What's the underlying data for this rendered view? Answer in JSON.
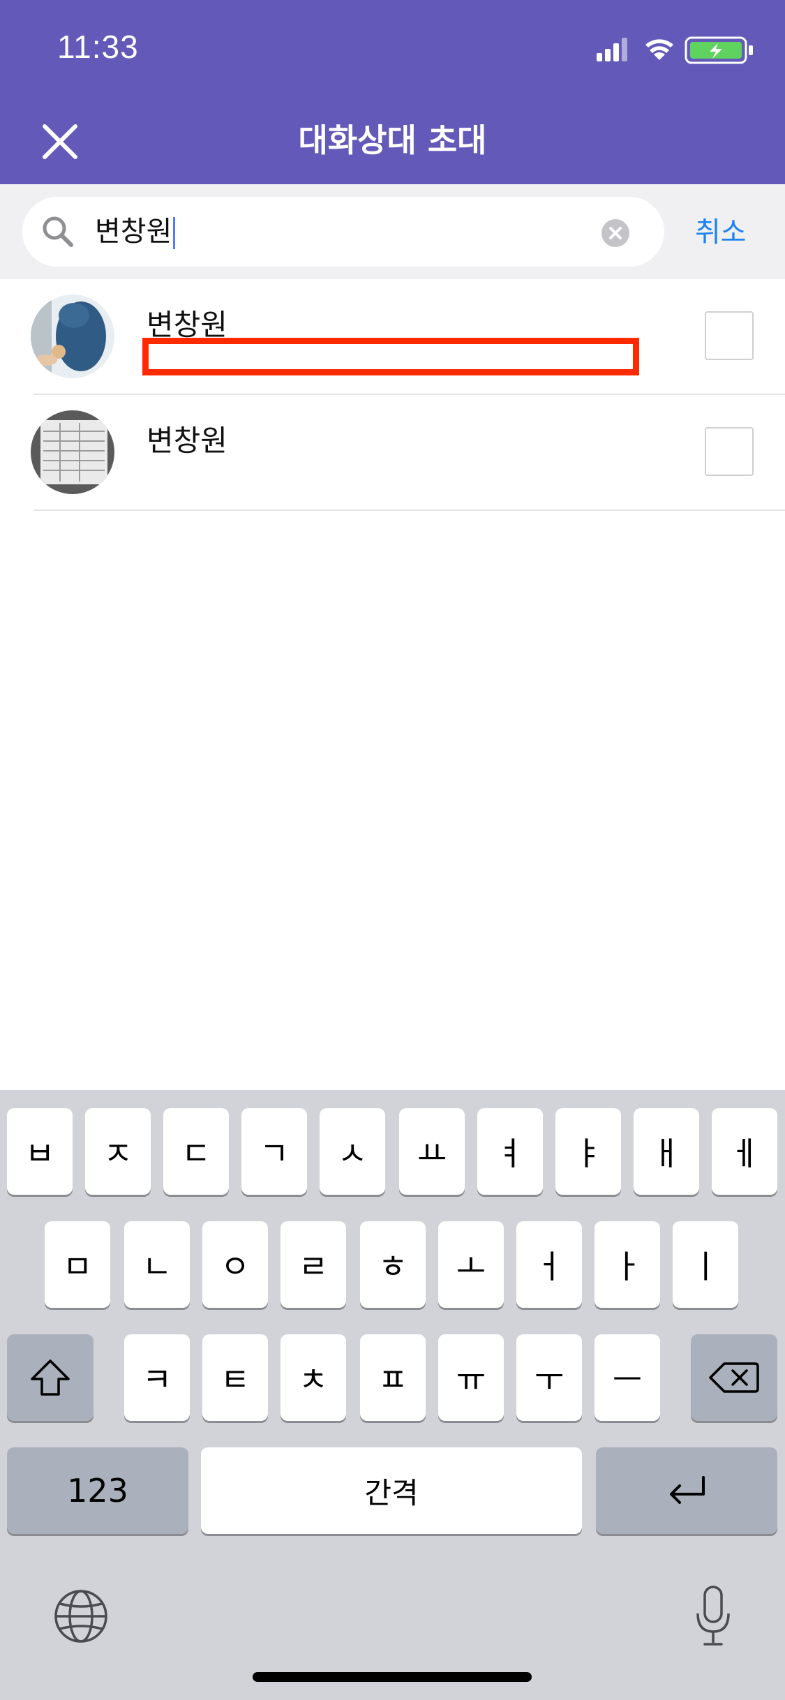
{
  "status_bar": {
    "time": "11:33"
  },
  "header": {
    "title": "대화상대 초대"
  },
  "search": {
    "value": "변창원",
    "cancel_label": "취소"
  },
  "contacts": [
    {
      "name": "변창원"
    },
    {
      "name": "변창원"
    }
  ],
  "keyboard": {
    "row1": [
      "ㅂ",
      "ㅈ",
      "ㄷ",
      "ㄱ",
      "ㅅ",
      "ㅛ",
      "ㅕ",
      "ㅑ",
      "ㅐ",
      "ㅔ"
    ],
    "row2": [
      "ㅁ",
      "ㄴ",
      "ㅇ",
      "ㄹ",
      "ㅎ",
      "ㅗ",
      "ㅓ",
      "ㅏ",
      "ㅣ"
    ],
    "row3": [
      "ㅋ",
      "ㅌ",
      "ㅊ",
      "ㅍ",
      "ㅠ",
      "ㅜ",
      "ㅡ"
    ],
    "numbers_label": "123",
    "space_label": "간격"
  },
  "colors": {
    "header_bg": "#6259b8",
    "accent_link": "#1f82f1",
    "highlight_red": "#ff2a00",
    "keyboard_bg": "#d1d3d9"
  }
}
